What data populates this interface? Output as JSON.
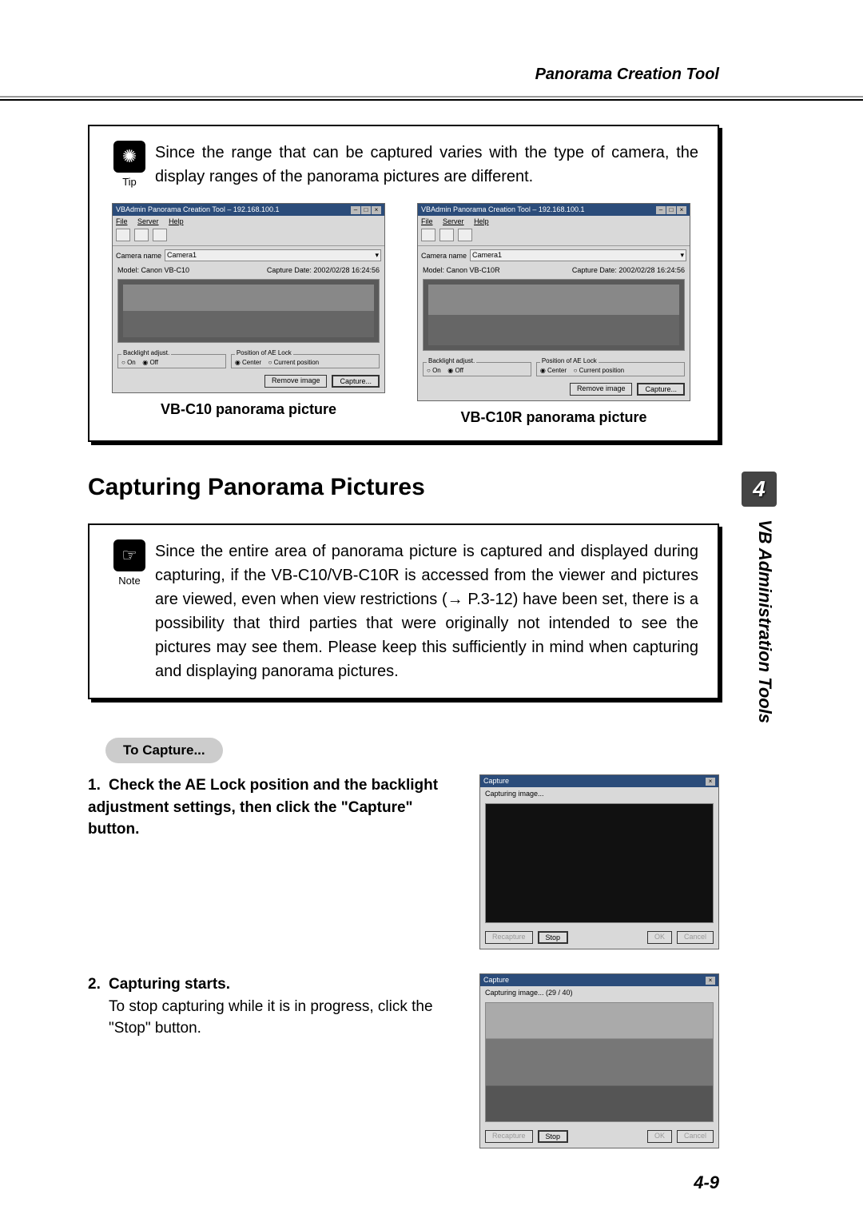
{
  "header": {
    "title": "Panorama Creation Tool"
  },
  "chapter": {
    "num": "4",
    "label": "VB Administration Tools"
  },
  "page_number": "4-9",
  "tip": {
    "label": "Tip",
    "text": "Since the range that can be captured varies with the type of camera, the display ranges of the panorama pictures are different."
  },
  "appwin": {
    "title_prefix": "VBAdmin Panorama Creation Tool – 192.168.100.1",
    "menus": {
      "file": "File",
      "server": "Server",
      "help": "Help"
    },
    "camera_name_label": "Camera name",
    "camera_name_value": "Camera1",
    "model_label": "Model:",
    "capture_date_label": "Capture Date:",
    "capture_date_value": "2002/02/28 16:24:56",
    "group_backlight": "Backlight adjust.",
    "group_aelock": "Position of AE Lock",
    "opt_on": "On",
    "opt_off": "Off",
    "opt_center": "Center",
    "opt_current": "Current position",
    "btn_remove": "Remove image",
    "btn_capture": "Capture..."
  },
  "fig_left": {
    "model_value": "Canon VB-C10",
    "caption": "VB-C10 panorama picture"
  },
  "fig_right": {
    "model_value": "Canon VB-C10R",
    "caption": "VB-C10R panorama picture"
  },
  "h2": "Capturing Panorama Pictures",
  "note": {
    "label": "Note",
    "text": "Since the entire area of panorama picture is captured and displayed during capturing, if the VB-C10/VB-C10R is accessed from the viewer and pictures are viewed, even when view restrictions (→ P.3-12) have been set, there is a possibility that third parties that were originally not intended to see the pictures may see them. Please keep this sufficiently in mind when capturing and displaying panorama pictures."
  },
  "procedure": {
    "heading": "To Capture..."
  },
  "step1": {
    "num": "1.",
    "text": "Check the AE Lock position and the backlight adjustment settings, then click the \"Capture\" button."
  },
  "step2": {
    "num": "2.",
    "lead": "Capturing starts.",
    "body": "To stop capturing while it is in progress, click the \"Stop\" button."
  },
  "capture_dialog": {
    "title": "Capture",
    "status_init": "Capturing image...",
    "status_progress": "Capturing image...  (29 / 40)",
    "btn_recapture": "Recapture",
    "btn_stop": "Stop",
    "btn_ok": "OK",
    "btn_cancel": "Cancel"
  }
}
